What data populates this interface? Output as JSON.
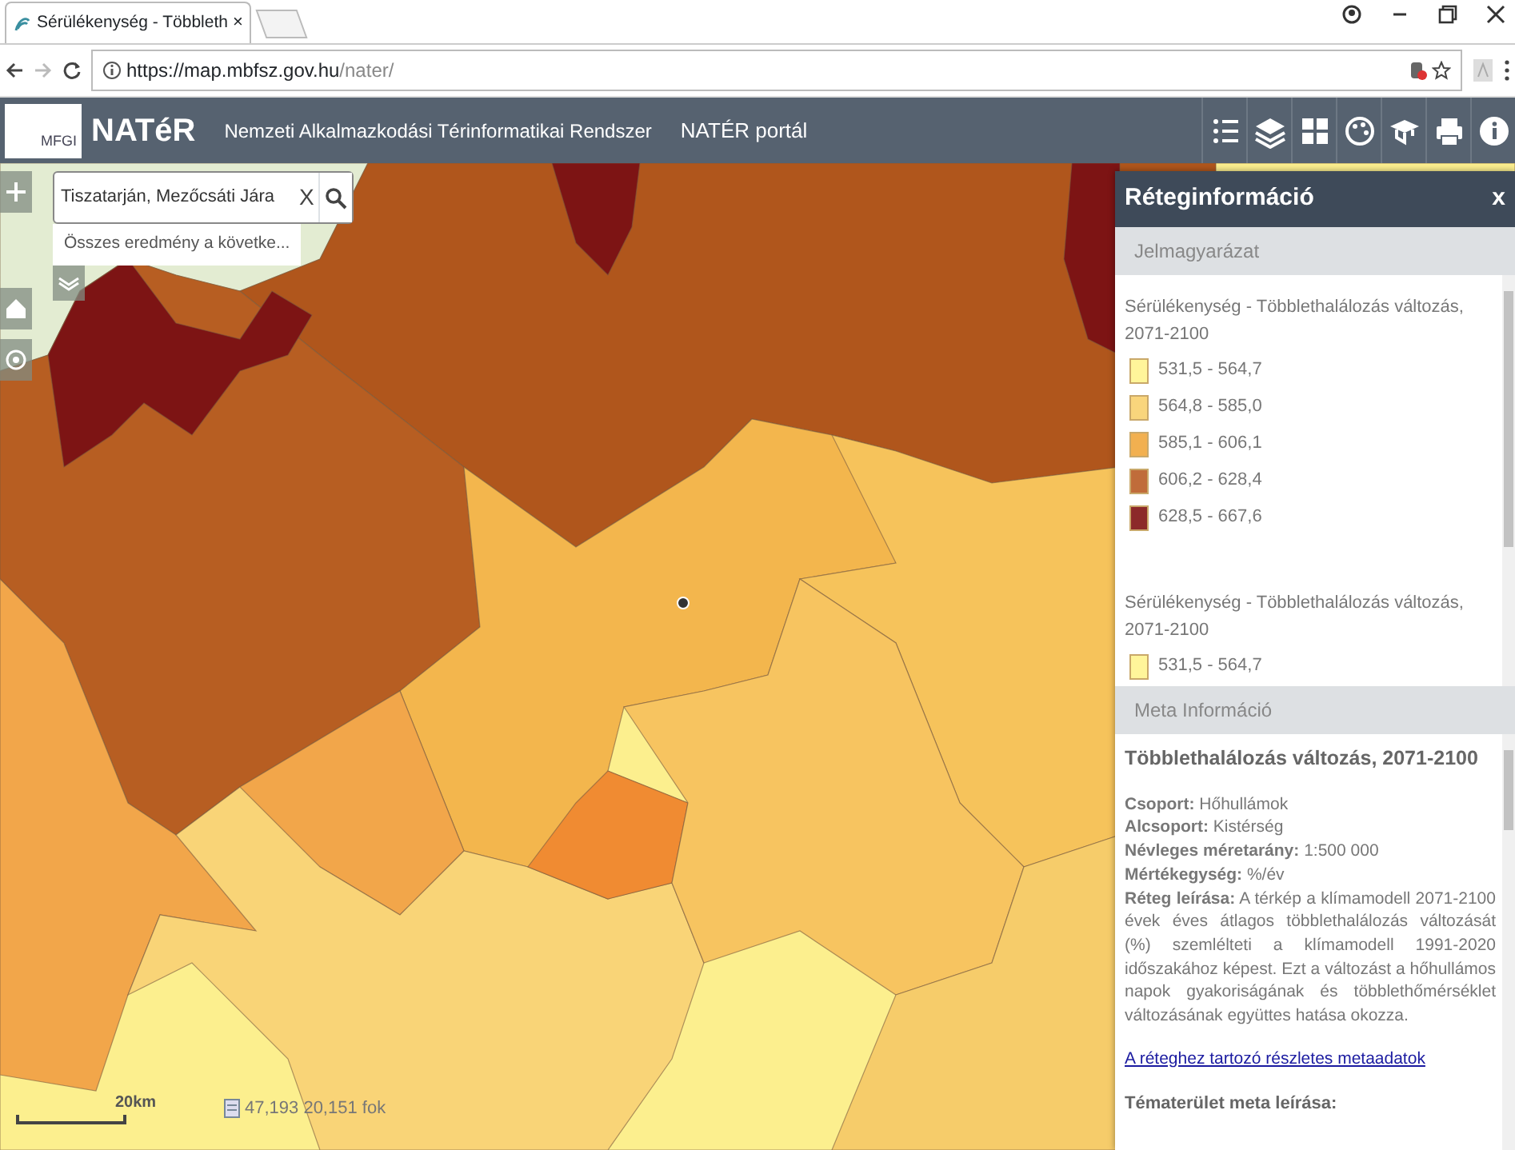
{
  "browser": {
    "tab_title": "Sérülékenység - Többleth",
    "close_tab": "×",
    "url_host": "https://map.mbfsz.gov.hu",
    "url_path": "/nater/"
  },
  "app": {
    "logo_text": "MFGI",
    "title": "NATéR",
    "nav_links": [
      "Nemzeti Alkalmazkodási Térinformatikai Rendszer",
      "NATÉR portál"
    ]
  },
  "search": {
    "value": "Tiszatarján, Mezőcsáti Jára",
    "clear": "X",
    "result": "Összes eredmény a követke..."
  },
  "map": {
    "scale": "20km",
    "coordinates": "47,193  20,151 fok"
  },
  "panel": {
    "title": "Réteginformáció",
    "close": "x",
    "legend_header": "Jelmagyarázat",
    "legend_groups": [
      {
        "title": "Sérülékenység - Többlethalálozás változás, 2071-2100",
        "items": [
          {
            "label": "531,5 - 564,7",
            "color": "#fff59a"
          },
          {
            "label": "564,8 - 585,0",
            "color": "#f9d57c"
          },
          {
            "label": "585,1 - 606,1",
            "color": "#f2b050"
          },
          {
            "label": "606,2 - 628,4",
            "color": "#c06c3a"
          },
          {
            "label": "628,5 - 667,6",
            "color": "#8c2a2a"
          }
        ]
      },
      {
        "title": "Sérülékenység - Többlethalálozás változás, 2071-2100",
        "items": [
          {
            "label": "531,5 - 564,7",
            "color": "#fff59a"
          }
        ]
      }
    ],
    "meta_header": "Meta Információ",
    "meta_title": "Többlethalálozás változás, 2071-2100",
    "meta_fields": [
      "**Csoport:** Hőhullámok",
      "**Alcsoport:** Kistérség",
      "**Névleges méretarány:** 1:500 000",
      "**Mértékegység:** %/év"
    ],
    "description": "**Réteg leírása:** A térkép a klímamodell 2071-2100 évek éves átlagos többlethalálozás változását (%) szemlélteti a klímamodell 1991-2020 időszakához képest. Ezt a változást a hőhullámos napok gyakoriságának és többlethőmérséklet változásának együttes hatása okozza.",
    "link": "A réteghez tartozó részletes metaadatok",
    "theme_heading": "Tématerület meta leírása:"
  }
}
